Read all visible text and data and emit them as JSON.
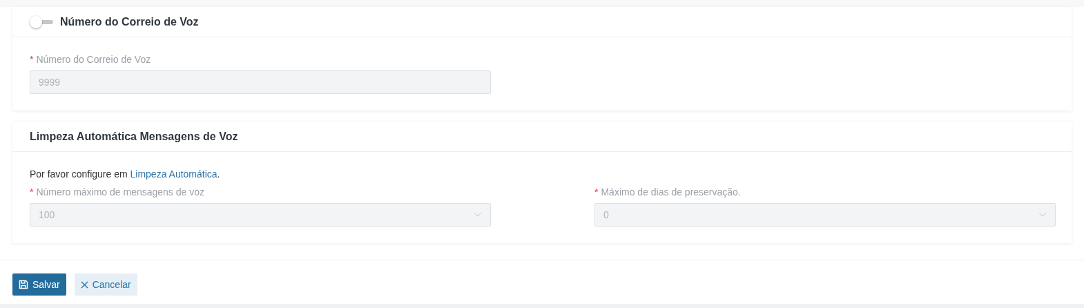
{
  "voicemail_number": {
    "title": "Número do Correio de Voz",
    "toggle": {
      "on": false
    },
    "fields": [
      {
        "required_mark": "*",
        "label": "Número do Correio de Voz",
        "value": "9999",
        "disabled": true
      }
    ]
  },
  "auto_cleanup": {
    "title": "Limpeza Automática Mensagens de Voz",
    "note": "Por favor configure em ",
    "note_link": "Limpeza Automática",
    "note_end": ".",
    "fields": [
      {
        "required_mark": "*",
        "label": "Número máximo de mensagens de voz",
        "value": "100",
        "kind": "select",
        "disabled": true
      },
      {
        "required_mark": "*",
        "label": "Máximo de dias de preservação.",
        "value": "0",
        "kind": "select",
        "disabled": true
      }
    ]
  },
  "buttons": [
    {
      "label": "Salvar",
      "kind": "save"
    },
    {
      "label": "Cancelar",
      "kind": "cancel"
    }
  ]
}
